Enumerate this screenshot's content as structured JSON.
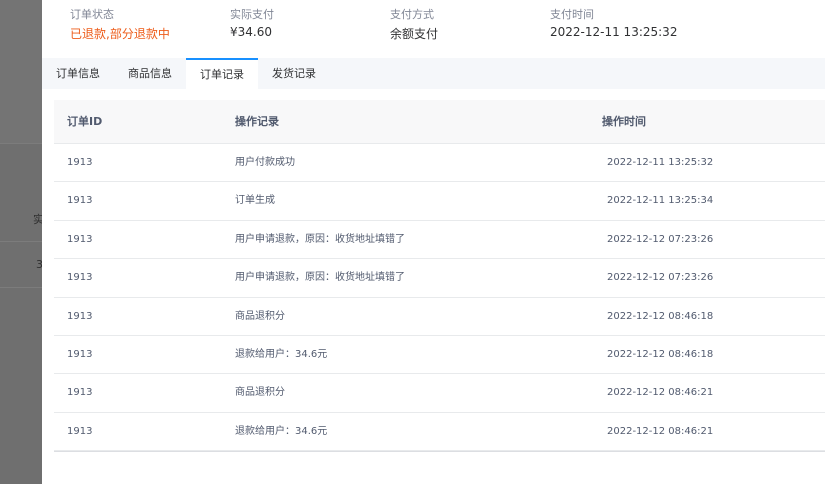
{
  "backdrop": {
    "fragment_1": "实",
    "fragment_2": "3"
  },
  "summary": {
    "fields": [
      {
        "label": "订单状态",
        "value": "已退款,部分退款中"
      },
      {
        "label": "实际支付",
        "value": "¥34.60"
      },
      {
        "label": "支付方式",
        "value": "余额支付"
      },
      {
        "label": "支付时间",
        "value": "2022-12-11 13:25:32"
      }
    ]
  },
  "tabs": [
    {
      "label": "订单信息",
      "active": false
    },
    {
      "label": "商品信息",
      "active": false
    },
    {
      "label": "订单记录",
      "active": true
    },
    {
      "label": "发货记录",
      "active": false
    }
  ],
  "colors": {
    "accent": "#1890ff",
    "status_refund": "#ed5c1a",
    "header_bg": "#f8f8f9",
    "backdrop": "#6f6f6f"
  },
  "table": {
    "columns": [
      "订单ID",
      "操作记录",
      "操作时间"
    ],
    "rows": [
      {
        "id": "1913",
        "action": "用户付款成功",
        "time": "2022-12-11 13:25:32"
      },
      {
        "id": "1913",
        "action": "订单生成",
        "time": "2022-12-11 13:25:34"
      },
      {
        "id": "1913",
        "action": "用户申请退款，原因：收货地址填错了",
        "time": "2022-12-12 07:23:26"
      },
      {
        "id": "1913",
        "action": "用户申请退款，原因：收货地址填错了",
        "time": "2022-12-12 07:23:26"
      },
      {
        "id": "1913",
        "action": "商品退积分",
        "time": "2022-12-12 08:46:18"
      },
      {
        "id": "1913",
        "action": "退款给用户：34.6元",
        "time": "2022-12-12 08:46:18"
      },
      {
        "id": "1913",
        "action": "商品退积分",
        "time": "2022-12-12 08:46:21"
      },
      {
        "id": "1913",
        "action": "退款给用户：34.6元",
        "time": "2022-12-12 08:46:21"
      }
    ]
  }
}
